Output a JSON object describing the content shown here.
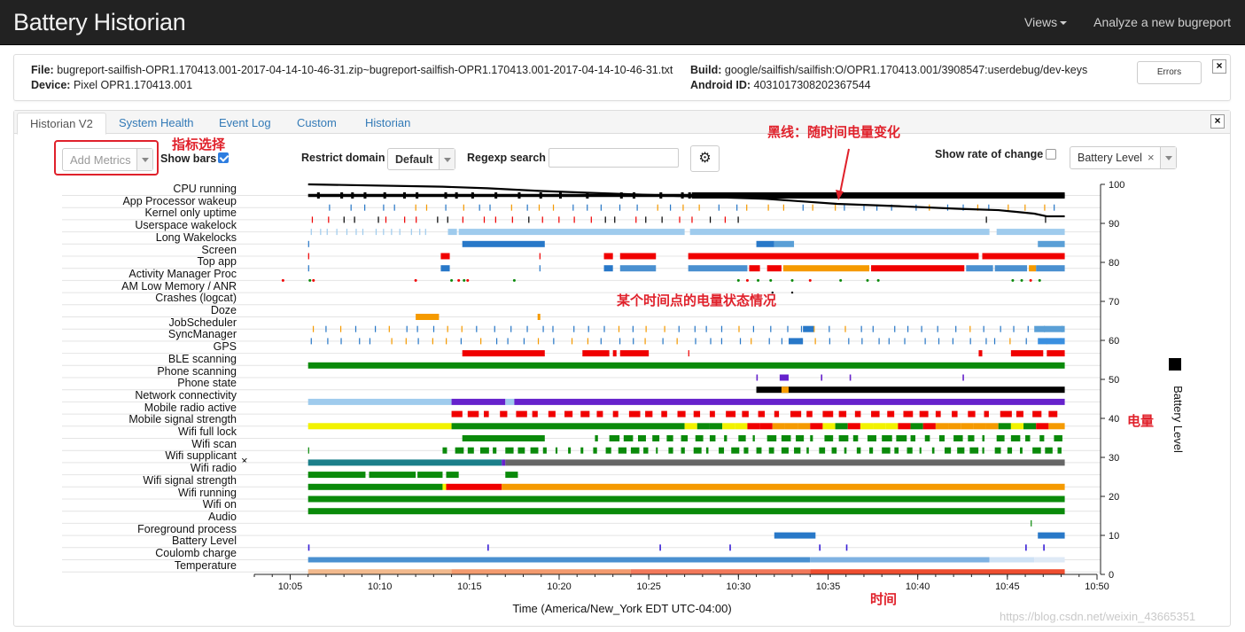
{
  "app": {
    "title": "Battery Historian",
    "nav": {
      "views": "Views",
      "analyze": "Analyze a new bugreport"
    }
  },
  "file_info": {
    "file_label": "File:",
    "file_value": "bugreport-sailfish-OPR1.170413.001-2017-04-14-10-46-31.zip~bugreport-sailfish-OPR1.170413.001-2017-04-14-10-46-31.txt",
    "device_label": "Device:",
    "device_value": "Pixel OPR1.170413.001",
    "build_label": "Build:",
    "build_value": "google/sailfish/sailfish:O/OPR1.170413.001/3908547:userdebug/dev-keys",
    "android_id_label": "Android ID:",
    "android_id_value": "4031017308202367544",
    "errors_button": "Errors"
  },
  "tabs": [
    "Historian V2",
    "System Health",
    "Event Log",
    "Custom",
    "Historian"
  ],
  "controls": {
    "add_metrics_placeholder": "Add Metrics",
    "show_bars": "Show bars",
    "show_bars_checked": true,
    "restrict_domain": "Restrict domain",
    "domain_value": "Default",
    "regexp_search": "Regexp search",
    "regexp_value": "",
    "show_rate_of_change": "Show rate of change",
    "show_rate_checked": false,
    "battery_select": "Battery Level"
  },
  "annotations": {
    "add_metrics_note": "指标选择",
    "black_line_note": "黑线：随时间电量变化",
    "state_note": "某个时间点的电量状态情况",
    "battery_note": "电量",
    "time_note": "时间"
  },
  "chart_data": {
    "type": "timeline",
    "xlabel": "Time (America/New_York EDT UTC-04:00)",
    "ylabel": "Battery Level",
    "x_ticks": [
      "10:05",
      "10:10",
      "10:15",
      "10:20",
      "10:25",
      "10:30",
      "10:35",
      "10:40",
      "10:45",
      "10:50"
    ],
    "x_range_min": [
      3.0,
      50.0
    ],
    "y_ticks": [
      0,
      10,
      20,
      30,
      40,
      50,
      60,
      70,
      80,
      90,
      100
    ],
    "ylim": [
      0,
      100
    ],
    "rows": [
      "CPU running",
      "App Processor wakeup",
      "Kernel only uptime",
      "Userspace wakelock",
      "Long Wakelocks",
      "Screen",
      "Top app",
      "Activity Manager Proc",
      "AM Low Memory / ANR",
      "Crashes (logcat)",
      "Doze",
      "JobScheduler",
      "SyncManager",
      "GPS",
      "BLE scanning",
      "Phone scanning",
      "Phone state",
      "Network connectivity",
      "Mobile radio active",
      "Mobile signal strength",
      "Wifi full lock",
      "Wifi scan",
      "Wifi supplicant",
      "Wifi radio",
      "Wifi signal strength",
      "Wifi running",
      "Wifi on",
      "Audio",
      "Foreground process",
      "Battery Level",
      "Coulomb charge",
      "Temperature"
    ],
    "wifi_supplicant_close": "×",
    "battery_level_series": {
      "name": "Battery Level",
      "x_min": [
        6.0,
        13.5,
        16.0,
        19.0,
        22.0,
        25.0,
        28.0,
        31.5,
        35.5,
        39.0,
        42.5,
        44.5,
        46.5,
        47.2,
        48.2
      ],
      "y": [
        100,
        99.4,
        99,
        98.3,
        97.8,
        97.3,
        96.8,
        96.3,
        95,
        94.4,
        93.7,
        93.4,
        92.5,
        91.8,
        91.8
      ]
    }
  }
}
